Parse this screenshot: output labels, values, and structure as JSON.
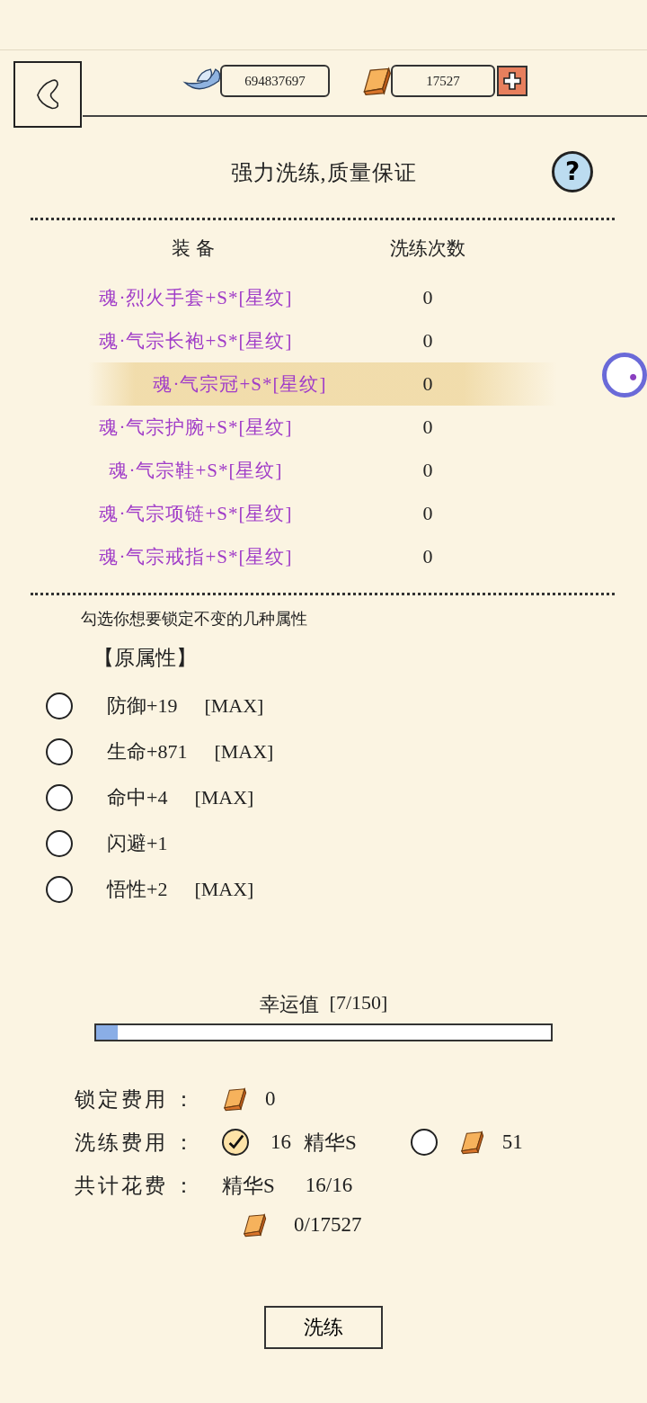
{
  "currencies": [
    {
      "kind": "silver",
      "amount": "694837697",
      "addable": false
    },
    {
      "kind": "gold",
      "amount": "17527",
      "addable": true
    }
  ],
  "title": "强力洗练,质量保证",
  "help_button": "?",
  "equipment_table": {
    "columns": [
      "装备",
      "洗练次数"
    ],
    "rows": [
      {
        "name": "魂·烈火手套+S*[星纹]",
        "count": "0",
        "selected": false
      },
      {
        "name": "魂·气宗长袍+S*[星纹]",
        "count": "0",
        "selected": false
      },
      {
        "name": "魂·气宗冠+S*[星纹]",
        "count": "0",
        "selected": true
      },
      {
        "name": "魂·气宗护腕+S*[星纹]",
        "count": "0",
        "selected": false
      },
      {
        "name": "魂·气宗鞋+S*[星纹]",
        "count": "0",
        "selected": false
      },
      {
        "name": "魂·气宗项链+S*[星纹]",
        "count": "0",
        "selected": false
      },
      {
        "name": "魂·气宗戒指+S*[星纹]",
        "count": "0",
        "selected": false
      }
    ]
  },
  "lock_hint": "勾选你想要锁定不变的几种属性",
  "attributes_heading": "【原属性】",
  "attributes": [
    {
      "text": "防御+19",
      "tag": "[MAX]",
      "checked": false
    },
    {
      "text": "生命+871",
      "tag": "[MAX]",
      "checked": false
    },
    {
      "text": "命中+4",
      "tag": "[MAX]",
      "checked": false
    },
    {
      "text": "闪避+1",
      "checked": false
    },
    {
      "text": "悟性+2",
      "tag": "[MAX]",
      "checked": false
    }
  ],
  "luck": {
    "label": "幸运值",
    "reading": "[7/150]",
    "level": 0.047
  },
  "costs": {
    "lock": {
      "label": "锁定费用",
      "colon": "：",
      "amount": "0"
    },
    "refine": {
      "label": "洗练费用",
      "colon": "：",
      "options": [
        {
          "kind": "essence",
          "amount": "16",
          "unit": "精华S",
          "selected": true
        },
        {
          "kind": "gold",
          "amount": "51",
          "selected": false
        }
      ]
    },
    "total": {
      "label": "共计花费",
      "colon": "：",
      "essence_unit": "精华S",
      "essence_amount": "16/16",
      "gold_amount": "0/17527"
    }
  },
  "refine_button": "洗练"
}
